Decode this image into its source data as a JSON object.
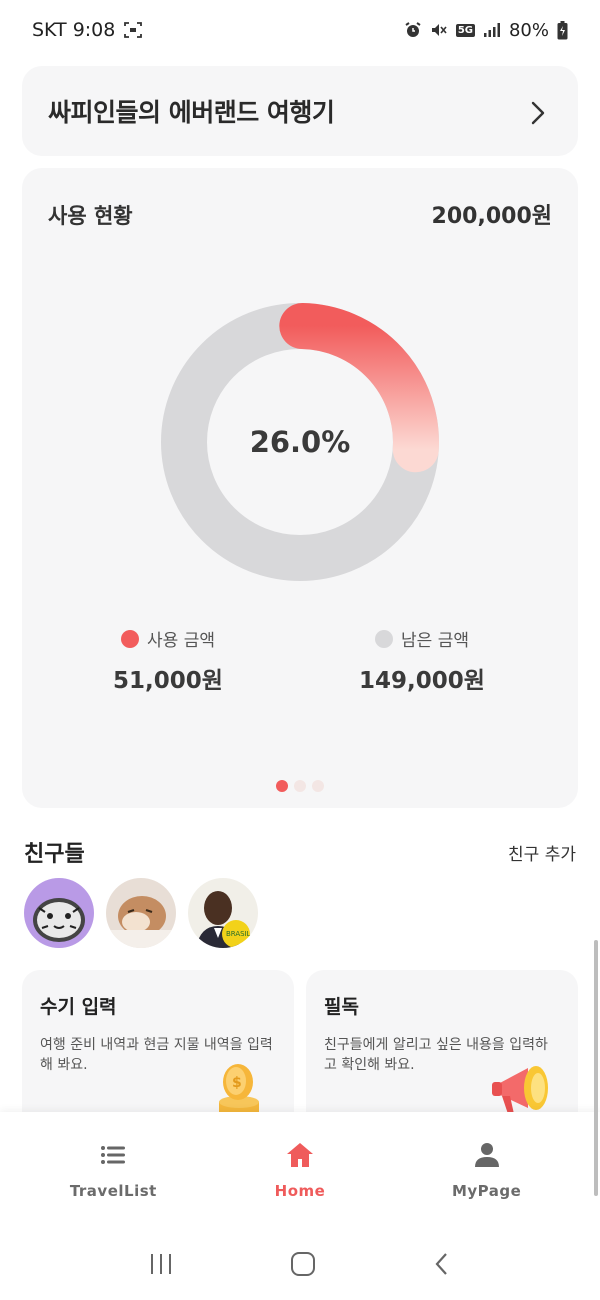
{
  "status_bar": {
    "carrier_time": "SKT 9:08",
    "network_badge": "5G",
    "battery": "80%",
    "icons": [
      "screenshot-icon",
      "alarm-icon",
      "mute-icon",
      "signal-icon",
      "battery-icon"
    ]
  },
  "trip": {
    "title": "싸피인들의 에버랜드 여행기"
  },
  "usage": {
    "title": "사용 현황",
    "total": "200,000원",
    "percent_label": "26.0%",
    "percent_value": 0.26,
    "used_label": "사용 금액",
    "used_amount": "51,000원",
    "remaining_label": "남은 금액",
    "remaining_amount": "149,000원",
    "pager": {
      "count": 3,
      "active": 0
    }
  },
  "friends": {
    "title": "친구들",
    "add_label": "친구 추가",
    "avatars": [
      "avatar-tiger-drawing",
      "avatar-cat-photo",
      "avatar-person-photo"
    ]
  },
  "features": {
    "manual": {
      "title": "수기 입력",
      "desc": "여행 준비 내역과 현금 지물 내역을 입력해 봐요."
    },
    "notice": {
      "title": "필독",
      "desc": "친구들에게 알리고 싶은 내용을 입력하고 확인해 봐요."
    }
  },
  "bottom_nav": {
    "items": [
      {
        "label": "TravelList",
        "icon": "list-icon"
      },
      {
        "label": "Home",
        "icon": "home-icon",
        "active": true
      },
      {
        "label": "MyPage",
        "icon": "person-icon"
      }
    ]
  },
  "colors": {
    "accent": "#EF5B5B",
    "donut_used_start": "#F25C5C",
    "donut_used_end": "#FCD9D3",
    "donut_remaining": "#D8D8DA",
    "card_bg": "#F6F6F7"
  }
}
